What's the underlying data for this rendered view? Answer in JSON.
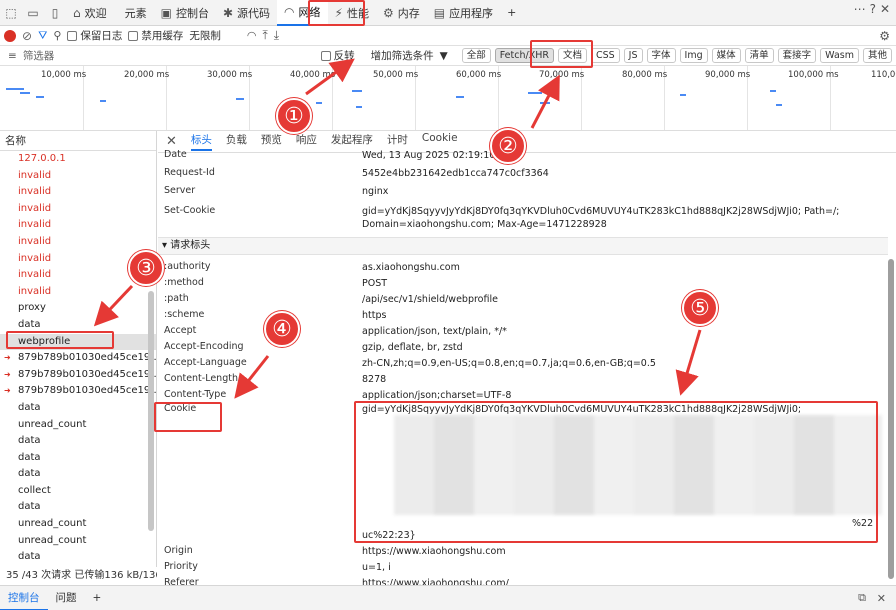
{
  "tabs": [
    {
      "label": "欢迎",
      "icon": "home-icon"
    },
    {
      "label": "元素",
      "icon": "code-icon"
    },
    {
      "label": "控制台",
      "icon": "console-icon"
    },
    {
      "label": "源代码",
      "icon": "bug-icon"
    },
    {
      "label": "网络",
      "icon": "wifi-icon"
    },
    {
      "label": "性能",
      "icon": "performance-icon"
    },
    {
      "label": "内存",
      "icon": "memory-icon"
    },
    {
      "label": "应用程序",
      "icon": "app-icon"
    }
  ],
  "add_tab": "+",
  "toolbar": {
    "preserve_log": "保留日志",
    "disable_cache": "禁用缓存",
    "throttling": "无限制"
  },
  "filter": {
    "placeholder": "筛选器",
    "invert": "反转",
    "more_filters": "增加筛选条件",
    "types": [
      "全部",
      "Fetch/XHR",
      "文档",
      "CSS",
      "JS",
      "字体",
      "Img",
      "媒体",
      "清单",
      "套接字",
      "Wasm",
      "其他"
    ]
  },
  "timeline_ticks": [
    "10,000 ms",
    "20,000 ms",
    "30,000 ms",
    "40,000 ms",
    "50,000 ms",
    "60,000 ms",
    "70,000 ms",
    "80,000 ms",
    "90,000 ms",
    "100,000 ms",
    "110,000"
  ],
  "namelist": {
    "header": "名称",
    "rows": [
      {
        "name": "127.0.0.1",
        "err": true
      },
      {
        "name": "invalid",
        "err": true
      },
      {
        "name": "invalid",
        "err": true
      },
      {
        "name": "invalid",
        "err": true
      },
      {
        "name": "invalid",
        "err": true
      },
      {
        "name": "invalid",
        "err": true
      },
      {
        "name": "invalid",
        "err": true
      },
      {
        "name": "invalid",
        "err": true
      },
      {
        "name": "invalid",
        "err": true
      },
      {
        "name": "proxy",
        "err": false
      },
      {
        "name": "data",
        "err": false
      },
      {
        "name": "webprofile",
        "err": false,
        "sel": true
      },
      {
        "name": "879b789b01030ed45ce19...",
        "err": false,
        "arrow": true
      },
      {
        "name": "879b789b01030ed45ce19...",
        "err": false,
        "arrow": true
      },
      {
        "name": "879b789b01030ed45ce19...",
        "err": false,
        "arrow": true
      },
      {
        "name": "data",
        "err": false
      },
      {
        "name": "unread_count",
        "err": false
      },
      {
        "name": "data",
        "err": false
      },
      {
        "name": "data",
        "err": false
      },
      {
        "name": "data",
        "err": false
      },
      {
        "name": "collect",
        "err": false
      },
      {
        "name": "data",
        "err": false
      },
      {
        "name": "unread_count",
        "err": false
      },
      {
        "name": "unread_count",
        "err": false
      },
      {
        "name": "data",
        "err": false
      }
    ],
    "footer": "35 /43 次请求   已传输136 kB/136"
  },
  "detail_tabs": [
    "标头",
    "负载",
    "预览",
    "响应",
    "发起程序",
    "计时",
    "Cookie"
  ],
  "response_headers": [
    {
      "k": "Date",
      "v": "Wed, 13 Aug 2025 02:19:10"
    },
    {
      "k": "Request-Id",
      "v": "5452e4bb231642edb1cca747c0cf3364"
    },
    {
      "k": "Server",
      "v": "nginx"
    },
    {
      "k": "Set-Cookie",
      "v": "gid=yYdKj8SqyyvJyYdKj8DY0fq3qYKVDluh0Cvd6MUVUY4uTK283kC1hd888qJK2j28WSdjWJi0; Path=/; Domain=xiaohongshu.com; Max-Age=1471228928"
    }
  ],
  "request_section": "▾ 请求标头",
  "request_headers": [
    {
      "k": ":authority",
      "v": "as.xiaohongshu.com"
    },
    {
      "k": ":method",
      "v": "POST"
    },
    {
      "k": ":path",
      "v": "/api/sec/v1/shield/webprofile"
    },
    {
      "k": ":scheme",
      "v": "https"
    },
    {
      "k": "Accept",
      "v": "application/json, text/plain, */*"
    },
    {
      "k": "Accept-Encoding",
      "v": "gzip, deflate, br, zstd"
    },
    {
      "k": "Accept-Language",
      "v": "zh-CN,zh;q=0.9,en-US;q=0.8,en;q=0.7,ja;q=0.6,en-GB;q=0.5"
    },
    {
      "k": "Content-Length",
      "v": "8278"
    },
    {
      "k": "Content-Type",
      "v": "application/json;charset=UTF-8"
    },
    {
      "k": "Cookie",
      "v": "gid=yYdKj8SqyyvJyYdKj8DY0fq3qYKVDluh0Cvd6MUVUY4uTK283kC1hd888qJK2j28WSdjWJi0;"
    }
  ],
  "cookie_tail": "uc%22:23}",
  "cookie_tail2": "%22",
  "after_headers": [
    {
      "k": "Origin",
      "v": "https://www.xiaohongshu.com"
    },
    {
      "k": "Priority",
      "v": "u=1, i"
    },
    {
      "k": "Referer",
      "v": "https://www.xiaohongshu.com/"
    }
  ],
  "drawer": {
    "console": "控制台",
    "issues": "问题",
    "add": "+"
  },
  "badges": [
    "①",
    "②",
    "③",
    "④",
    "⑤"
  ],
  "accent": "#e53935"
}
